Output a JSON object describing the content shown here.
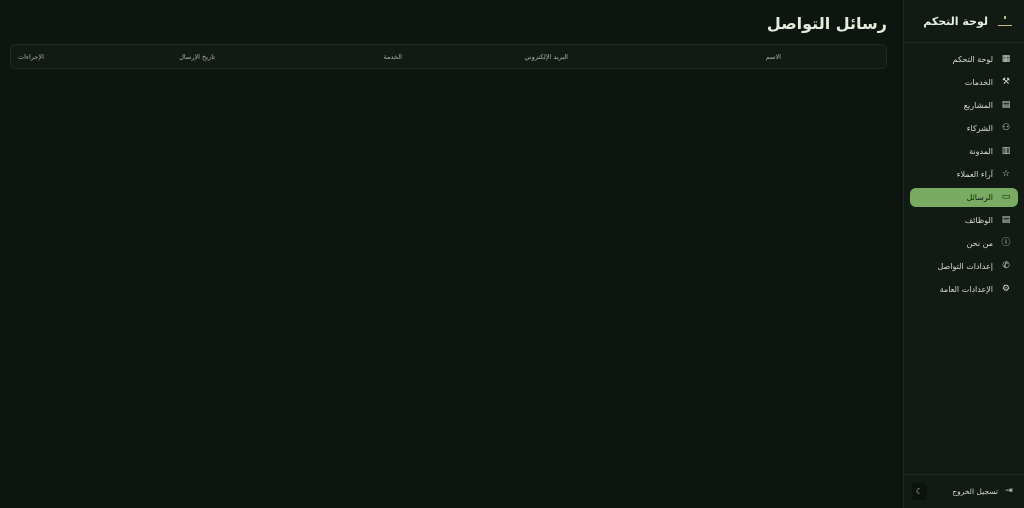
{
  "sidebar": {
    "title": "لوحة التحكم",
    "items": [
      {
        "label": "لوحة التحكم",
        "icon": "grid-icon"
      },
      {
        "label": "الخدمات",
        "icon": "wrench-icon"
      },
      {
        "label": "المشاريع",
        "icon": "briefcase-icon"
      },
      {
        "label": "الشركاء",
        "icon": "users-icon"
      },
      {
        "label": "المدونة",
        "icon": "newspaper-icon"
      },
      {
        "label": "آراء العملاء",
        "icon": "star-icon"
      },
      {
        "label": "الرسائل",
        "icon": "message-icon",
        "active": true
      },
      {
        "label": "الوظائف",
        "icon": "briefcase-icon"
      },
      {
        "label": "من نحن",
        "icon": "info-icon"
      },
      {
        "label": "إعدادات التواصل",
        "icon": "phone-icon"
      },
      {
        "label": "الإعدادات العامة",
        "icon": "gear-icon"
      }
    ],
    "logout": "تسجيل الخروج"
  },
  "main": {
    "title": "رسائل التواصل",
    "columns": [
      "الاسم",
      "البريد الإلكتروني",
      "الخدمة",
      "تاريخ الإرسال",
      "الإجراءات"
    ]
  },
  "colors": {
    "accent": "#7aab63",
    "background": "#0c150f"
  }
}
